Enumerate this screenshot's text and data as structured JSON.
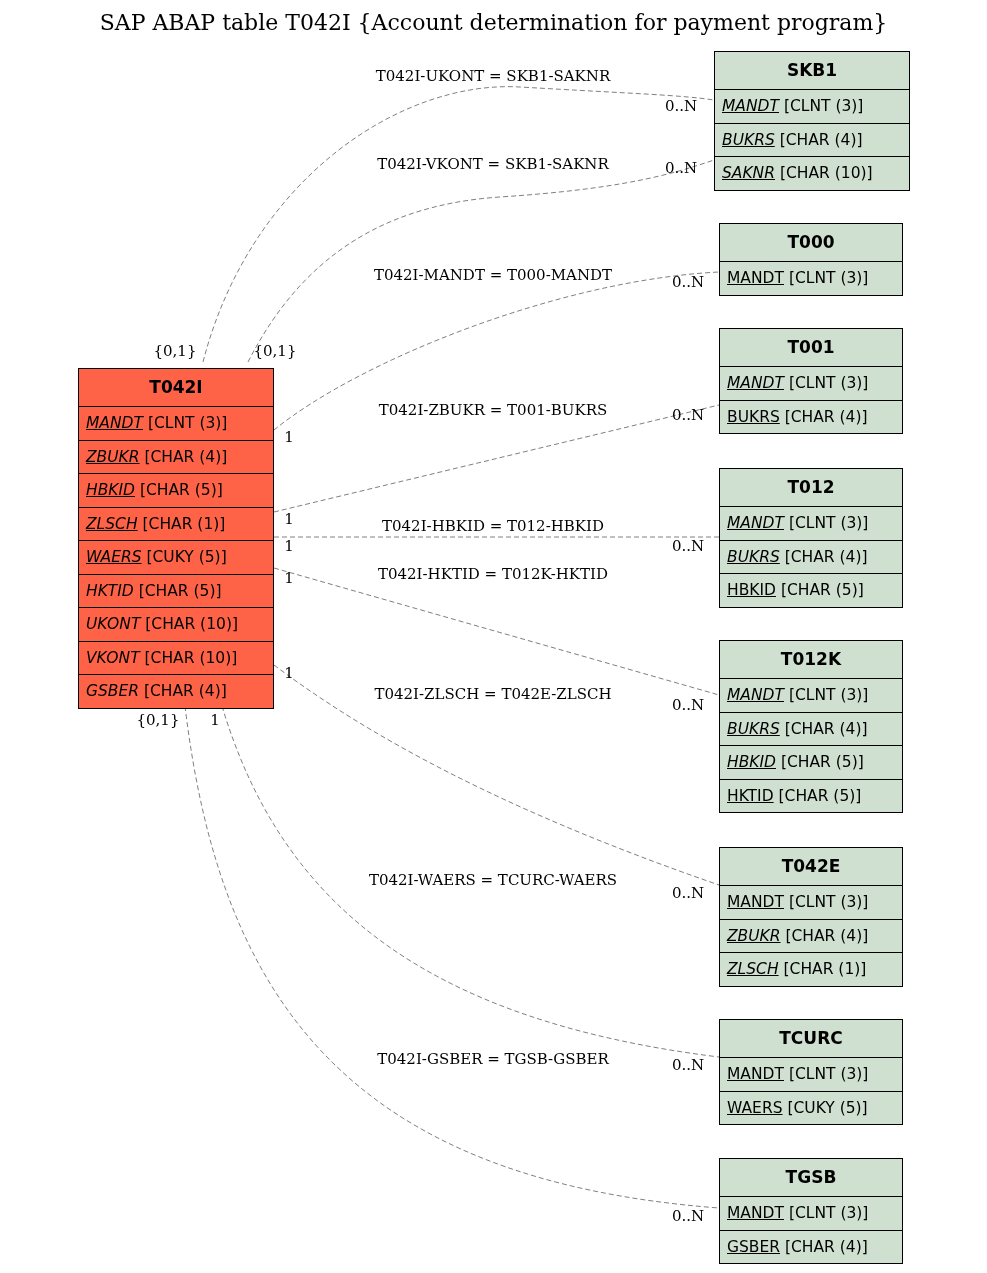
{
  "title": "SAP ABAP table T042I {Account determination for payment program}",
  "tables": [
    {
      "name": "T042I",
      "color": "#ff6347",
      "fields": [
        {
          "name": "MANDT",
          "type": "[CLNT (3)]",
          "key": true,
          "italic": true
        },
        {
          "name": "ZBUKR",
          "type": "[CHAR (4)]",
          "key": true,
          "italic": true
        },
        {
          "name": "HBKID",
          "type": "[CHAR (5)]",
          "key": true,
          "italic": true
        },
        {
          "name": "ZLSCH",
          "type": "[CHAR (1)]",
          "key": true,
          "italic": true
        },
        {
          "name": "WAERS",
          "type": "[CUKY (5)]",
          "key": true,
          "italic": true
        },
        {
          "name": "HKTID",
          "type": "[CHAR (5)]",
          "key": false,
          "italic": true
        },
        {
          "name": "UKONT",
          "type": "[CHAR (10)]",
          "key": false,
          "italic": true
        },
        {
          "name": "VKONT",
          "type": "[CHAR (10)]",
          "key": false,
          "italic": true
        },
        {
          "name": "GSBER",
          "type": "[CHAR (4)]",
          "key": false,
          "italic": true
        }
      ]
    },
    {
      "name": "SKB1",
      "color": "#d0e0d0",
      "fields": [
        {
          "name": "MANDT",
          "type": "[CLNT (3)]",
          "key": true,
          "italic": true
        },
        {
          "name": "BUKRS",
          "type": "[CHAR (4)]",
          "key": true,
          "italic": true
        },
        {
          "name": "SAKNR",
          "type": "[CHAR (10)]",
          "key": true,
          "italic": true
        }
      ]
    },
    {
      "name": "T000",
      "color": "#d0e0d0",
      "fields": [
        {
          "name": "MANDT",
          "type": "[CLNT (3)]",
          "key": true,
          "italic": false
        }
      ]
    },
    {
      "name": "T001",
      "color": "#d0e0d0",
      "fields": [
        {
          "name": "MANDT",
          "type": "[CLNT (3)]",
          "key": true,
          "italic": true
        },
        {
          "name": "BUKRS",
          "type": "[CHAR (4)]",
          "key": true,
          "italic": false
        }
      ]
    },
    {
      "name": "T012",
      "color": "#d0e0d0",
      "fields": [
        {
          "name": "MANDT",
          "type": "[CLNT (3)]",
          "key": true,
          "italic": true
        },
        {
          "name": "BUKRS",
          "type": "[CHAR (4)]",
          "key": true,
          "italic": true
        },
        {
          "name": "HBKID",
          "type": "[CHAR (5)]",
          "key": true,
          "italic": false
        }
      ]
    },
    {
      "name": "T012K",
      "color": "#d0e0d0",
      "fields": [
        {
          "name": "MANDT",
          "type": "[CLNT (3)]",
          "key": true,
          "italic": true
        },
        {
          "name": "BUKRS",
          "type": "[CHAR (4)]",
          "key": true,
          "italic": true
        },
        {
          "name": "HBKID",
          "type": "[CHAR (5)]",
          "key": true,
          "italic": true
        },
        {
          "name": "HKTID",
          "type": "[CHAR (5)]",
          "key": true,
          "italic": false
        }
      ]
    },
    {
      "name": "T042E",
      "color": "#d0e0d0",
      "fields": [
        {
          "name": "MANDT",
          "type": "[CLNT (3)]",
          "key": true,
          "italic": false
        },
        {
          "name": "ZBUKR",
          "type": "[CHAR (4)]",
          "key": true,
          "italic": true
        },
        {
          "name": "ZLSCH",
          "type": "[CHAR (1)]",
          "key": true,
          "italic": true
        }
      ]
    },
    {
      "name": "TCURC",
      "color": "#d0e0d0",
      "fields": [
        {
          "name": "MANDT",
          "type": "[CLNT (3)]",
          "key": true,
          "italic": false
        },
        {
          "name": "WAERS",
          "type": "[CUKY (5)]",
          "key": true,
          "italic": false
        }
      ]
    },
    {
      "name": "TGSB",
      "color": "#d0e0d0",
      "fields": [
        {
          "name": "MANDT",
          "type": "[CLNT (3)]",
          "key": true,
          "italic": false
        },
        {
          "name": "GSBER",
          "type": "[CHAR (4)]",
          "key": true,
          "italic": false
        }
      ]
    }
  ],
  "relations": [
    {
      "label": "T042I-UKONT = SKB1-SAKNR",
      "from_cardinality": "{0,1}",
      "to_cardinality": "0..N"
    },
    {
      "label": "T042I-VKONT = SKB1-SAKNR",
      "from_cardinality": "{0,1}",
      "to_cardinality": "0..N"
    },
    {
      "label": "T042I-MANDT = T000-MANDT",
      "from_cardinality": "1",
      "to_cardinality": "0..N"
    },
    {
      "label": "T042I-ZBUKR = T001-BUKRS",
      "from_cardinality": "1",
      "to_cardinality": "0..N"
    },
    {
      "label": "T042I-HBKID = T012-HBKID",
      "from_cardinality": "1",
      "to_cardinality": "0..N"
    },
    {
      "label": "T042I-HKTID = T012K-HKTID",
      "from_cardinality": "1",
      "to_cardinality": "0..N"
    },
    {
      "label": "T042I-ZLSCH = T042E-ZLSCH",
      "from_cardinality": "1",
      "to_cardinality": "0..N"
    },
    {
      "label": "T042I-WAERS = TCURC-WAERS",
      "from_cardinality": "1",
      "to_cardinality": "0..N"
    },
    {
      "label": "T042I-GSBER = TGSB-GSBER",
      "from_cardinality": "{0,1}",
      "to_cardinality": "0..N"
    }
  ]
}
